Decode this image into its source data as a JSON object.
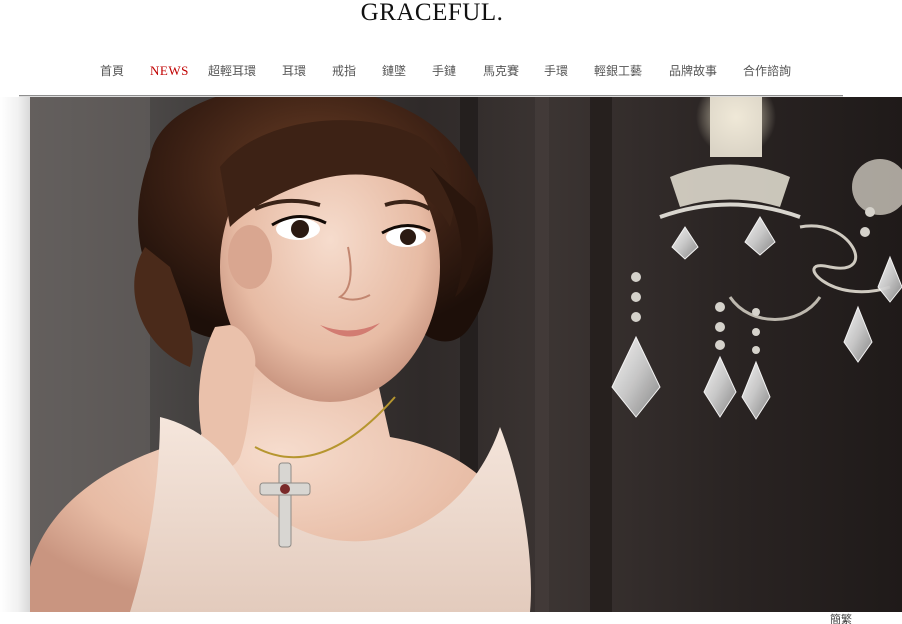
{
  "site": {
    "logo": "GRACEFUL."
  },
  "nav": {
    "items": [
      {
        "label": "首頁",
        "active": false
      },
      {
        "label": "NEWS",
        "active": true
      },
      {
        "label": "超輕耳環",
        "active": false
      },
      {
        "label": "耳環",
        "active": false
      },
      {
        "label": "戒指",
        "active": false
      },
      {
        "label": "鏈墜",
        "active": false
      },
      {
        "label": "手鏈",
        "active": false
      },
      {
        "label": "馬克賽",
        "active": false
      },
      {
        "label": "手環",
        "active": false
      },
      {
        "label": "輕銀工藝",
        "active": false
      },
      {
        "label": "品牌故事",
        "active": false
      },
      {
        "label": "合作諮詢",
        "active": false
      }
    ]
  },
  "hero": {
    "alt": ""
  },
  "footer": {
    "language_link": "簡繁"
  },
  "colors": {
    "active_nav": "#c00000",
    "nav_text": "#555555",
    "divider": "#8e8e8e"
  }
}
